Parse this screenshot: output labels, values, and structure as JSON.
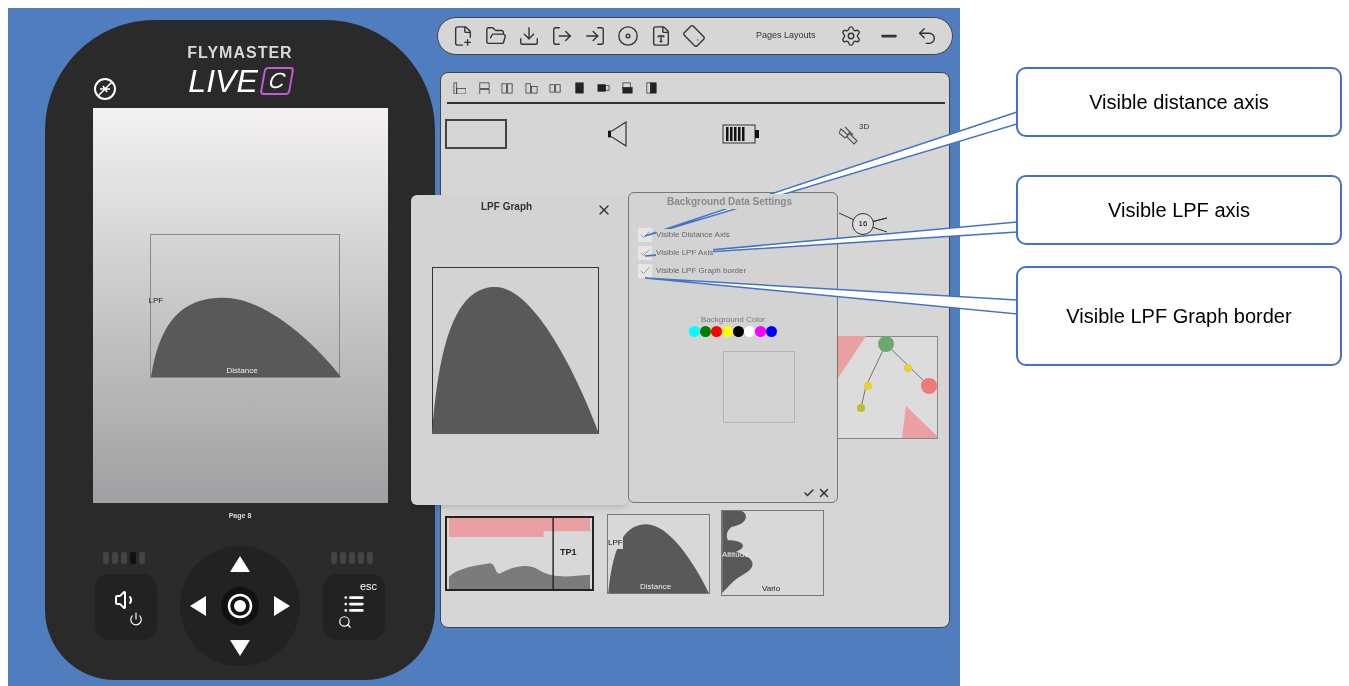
{
  "toolbar": {
    "title": "Pages Layouts"
  },
  "device": {
    "brand": "FLYMASTER",
    "model": "LIVE",
    "model_badge": "C",
    "page_label": "Page 8",
    "graph": {
      "y_label": "LPF",
      "x_label": "Distance"
    },
    "esc_label": "esc"
  },
  "layout_panel": {
    "satellite_badge": "3D",
    "wind_reading": "16",
    "thumbnails": [
      {
        "kind": "route",
        "label": "TP1"
      },
      {
        "kind": "lpf",
        "y_label": "LPF",
        "x_label": "Distance"
      },
      {
        "kind": "vario",
        "y_label": "Altitude",
        "x_label": "Vario"
      }
    ]
  },
  "lpf_dialog": {
    "title": "LPF Graph"
  },
  "settings_dialog": {
    "title": "Background Data Settings",
    "options": [
      {
        "label": "Visible Distance Axis",
        "checked": true
      },
      {
        "label": "Visible LPF Axis",
        "checked": true
      },
      {
        "label": "Visible LPF Graph border",
        "checked": true
      }
    ],
    "color_label": "Background Color",
    "colors": [
      {
        "color": "#00ffff"
      },
      {
        "color": "#008000"
      },
      {
        "color": "#ff0000"
      },
      {
        "color": "#ffff00"
      },
      {
        "color": "#000000"
      },
      {
        "color": "#ffffff"
      },
      {
        "color": "#ff00ff"
      },
      {
        "color": "#0000ff"
      }
    ]
  },
  "callouts": [
    {
      "text": "Visible distance axis"
    },
    {
      "text": "Visible LPF axis"
    },
    {
      "text": "Visible LPF Graph border"
    }
  ]
}
